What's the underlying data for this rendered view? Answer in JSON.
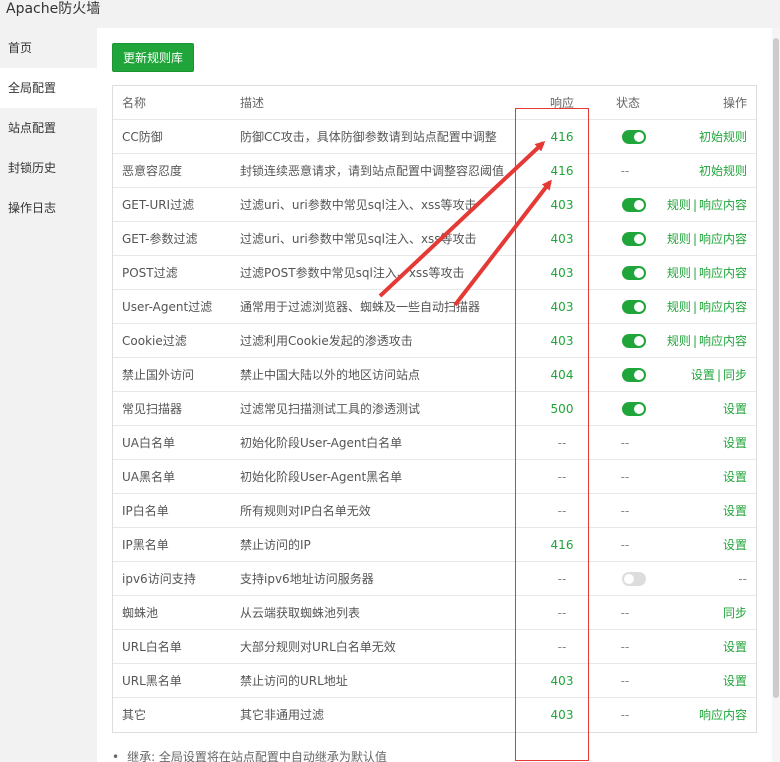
{
  "window": {
    "title": "Apache防火墙"
  },
  "sidebar": {
    "items": [
      {
        "label": "首页"
      },
      {
        "label": "全局配置",
        "active": true
      },
      {
        "label": "站点配置"
      },
      {
        "label": "封锁历史"
      },
      {
        "label": "操作日志"
      }
    ]
  },
  "toolbar": {
    "update_label": "更新规则库"
  },
  "table": {
    "headers": {
      "name": "名称",
      "desc": "描述",
      "resp": "响应",
      "status": "状态",
      "op": "操作"
    },
    "rows": [
      {
        "name": "CC防御",
        "desc": "防御CC攻击，具体防御参数请到站点配置中调整",
        "resp": "416",
        "status": "on",
        "op": [
          "初始规则"
        ]
      },
      {
        "name": "恶意容忍度",
        "desc": "封锁连续恶意请求，请到站点配置中调整容忍阈值",
        "resp": "416",
        "status": "--",
        "op": [
          "初始规则"
        ]
      },
      {
        "name": "GET-URI过滤",
        "desc": "过滤uri、uri参数中常见sql注入、xss等攻击",
        "resp": "403",
        "status": "on",
        "op": [
          "规则",
          "响应内容"
        ]
      },
      {
        "name": "GET-参数过滤",
        "desc": "过滤uri、uri参数中常见sql注入、xss等攻击",
        "resp": "403",
        "status": "on",
        "op": [
          "规则",
          "响应内容"
        ]
      },
      {
        "name": "POST过滤",
        "desc": "过滤POST参数中常见sql注入、xss等攻击",
        "resp": "403",
        "status": "on",
        "op": [
          "规则",
          "响应内容"
        ]
      },
      {
        "name": "User-Agent过滤",
        "desc": "通常用于过滤浏览器、蜘蛛及一些自动扫描器",
        "resp": "403",
        "status": "on",
        "op": [
          "规则",
          "响应内容"
        ]
      },
      {
        "name": "Cookie过滤",
        "desc": "过滤利用Cookie发起的渗透攻击",
        "resp": "403",
        "status": "on",
        "op": [
          "规则",
          "响应内容"
        ]
      },
      {
        "name": "禁止国外访问",
        "desc": "禁止中国大陆以外的地区访问站点",
        "resp": "404",
        "status": "on",
        "op": [
          "设置",
          "同步"
        ]
      },
      {
        "name": "常见扫描器",
        "desc": "过滤常见扫描测试工具的渗透测试",
        "resp": "500",
        "status": "on",
        "op": [
          "设置"
        ]
      },
      {
        "name": "UA白名单",
        "desc": "初始化阶段User-Agent白名单",
        "resp": "--",
        "status": "--",
        "op": [
          "设置"
        ]
      },
      {
        "name": "UA黑名单",
        "desc": "初始化阶段User-Agent黑名单",
        "resp": "--",
        "status": "--",
        "op": [
          "设置"
        ]
      },
      {
        "name": "IP白名单",
        "desc": "所有规则对IP白名单无效",
        "resp": "--",
        "status": "--",
        "op": [
          "设置"
        ]
      },
      {
        "name": "IP黑名单",
        "desc": "禁止访问的IP",
        "resp": "416",
        "status": "--",
        "op": [
          "设置"
        ]
      },
      {
        "name": "ipv6访问支持",
        "desc": "支持ipv6地址访问服务器",
        "resp": "--",
        "status": "off",
        "op": [
          "--"
        ]
      },
      {
        "name": "蜘蛛池",
        "desc": "从云端获取蜘蛛池列表",
        "resp": "--",
        "status": "--",
        "op": [
          "同步"
        ]
      },
      {
        "name": "URL白名单",
        "desc": "大部分规则对URL白名单无效",
        "resp": "--",
        "status": "--",
        "op": [
          "设置"
        ]
      },
      {
        "name": "URL黑名单",
        "desc": "禁止访问的URL地址",
        "resp": "403",
        "status": "--",
        "op": [
          "设置"
        ]
      },
      {
        "name": "其它",
        "desc": "其它非通用过滤",
        "resp": "403",
        "status": "--",
        "op": [
          "响应内容"
        ]
      }
    ]
  },
  "note": "继承: 全局设置将在站点配置中自动继承为默认值",
  "colors": {
    "accent": "#20a53a",
    "annotation": "#e53935"
  }
}
